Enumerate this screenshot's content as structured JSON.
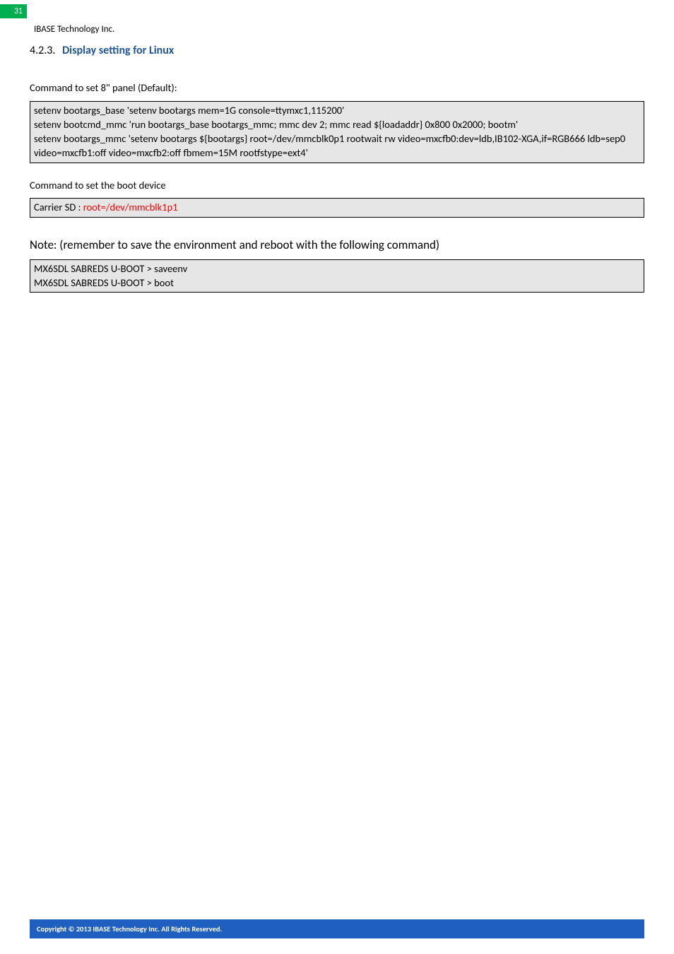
{
  "page_number": "31",
  "header": {
    "company": "IBASE Technology Inc."
  },
  "section": {
    "number": "4.2.3.",
    "title": "Display setting for Linux"
  },
  "para1": "Command to set 8\" panel (Default):",
  "codebox1": {
    "l1": "setenv bootargs_base 'setenv bootargs mem=1G console=ttymxc1,115200'",
    "l2": "setenv bootcmd_mmc 'run bootargs_base bootargs_mmc; mmc dev 2; mmc read ${loadaddr} 0x800 0x2000; bootm'",
    "l3": "setenv bootargs_mmc 'setenv bootargs ${bootargs} root=/dev/mmcblk0p1 rootwait rw video=mxcfb0:dev=ldb,IB102-XGA,if=RGB666 ldb=sep0 video=mxcfb1:off video=mxcfb2:off fbmem=15M rootfstype=ext4'"
  },
  "para2": "Command to set the boot device",
  "codebox2": {
    "prefix": "Carrier SD :    ",
    "red": "root=/dev/mmcblk1p1"
  },
  "note": "Note: (remember to save the environment and reboot with the following command)",
  "codebox3": {
    "l1": "MX6SDL SABREDS U-BOOT > saveenv",
    "l2": "MX6SDL SABREDS U-BOOT > boot"
  },
  "footer": "Copyright © 2013 IBASE Technology Inc. All Rights Reserved."
}
